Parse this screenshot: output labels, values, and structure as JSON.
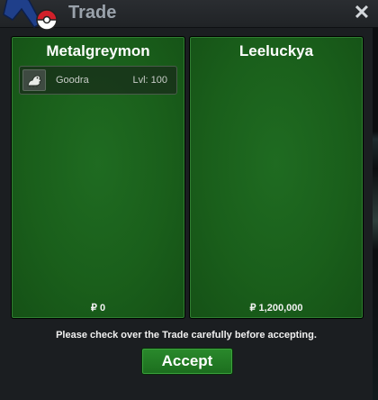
{
  "window": {
    "title": "Trade",
    "close_label": "✕"
  },
  "left_panel": {
    "player_name": "Metalgreymon",
    "items": [
      {
        "name": "Goodra",
        "level": "Lvl: 100",
        "icon": "goodra-sprite-icon"
      }
    ],
    "money": "₽ 0"
  },
  "right_panel": {
    "player_name": "Leeluckya",
    "items": [],
    "money": "₽ 1,200,000"
  },
  "message": "Please check over the Trade carefully before accepting.",
  "accept_label": "Accept",
  "colors": {
    "panel_green": "#1a5f1b",
    "button_green": "#22792a",
    "title_text": "#9aa2ab"
  }
}
